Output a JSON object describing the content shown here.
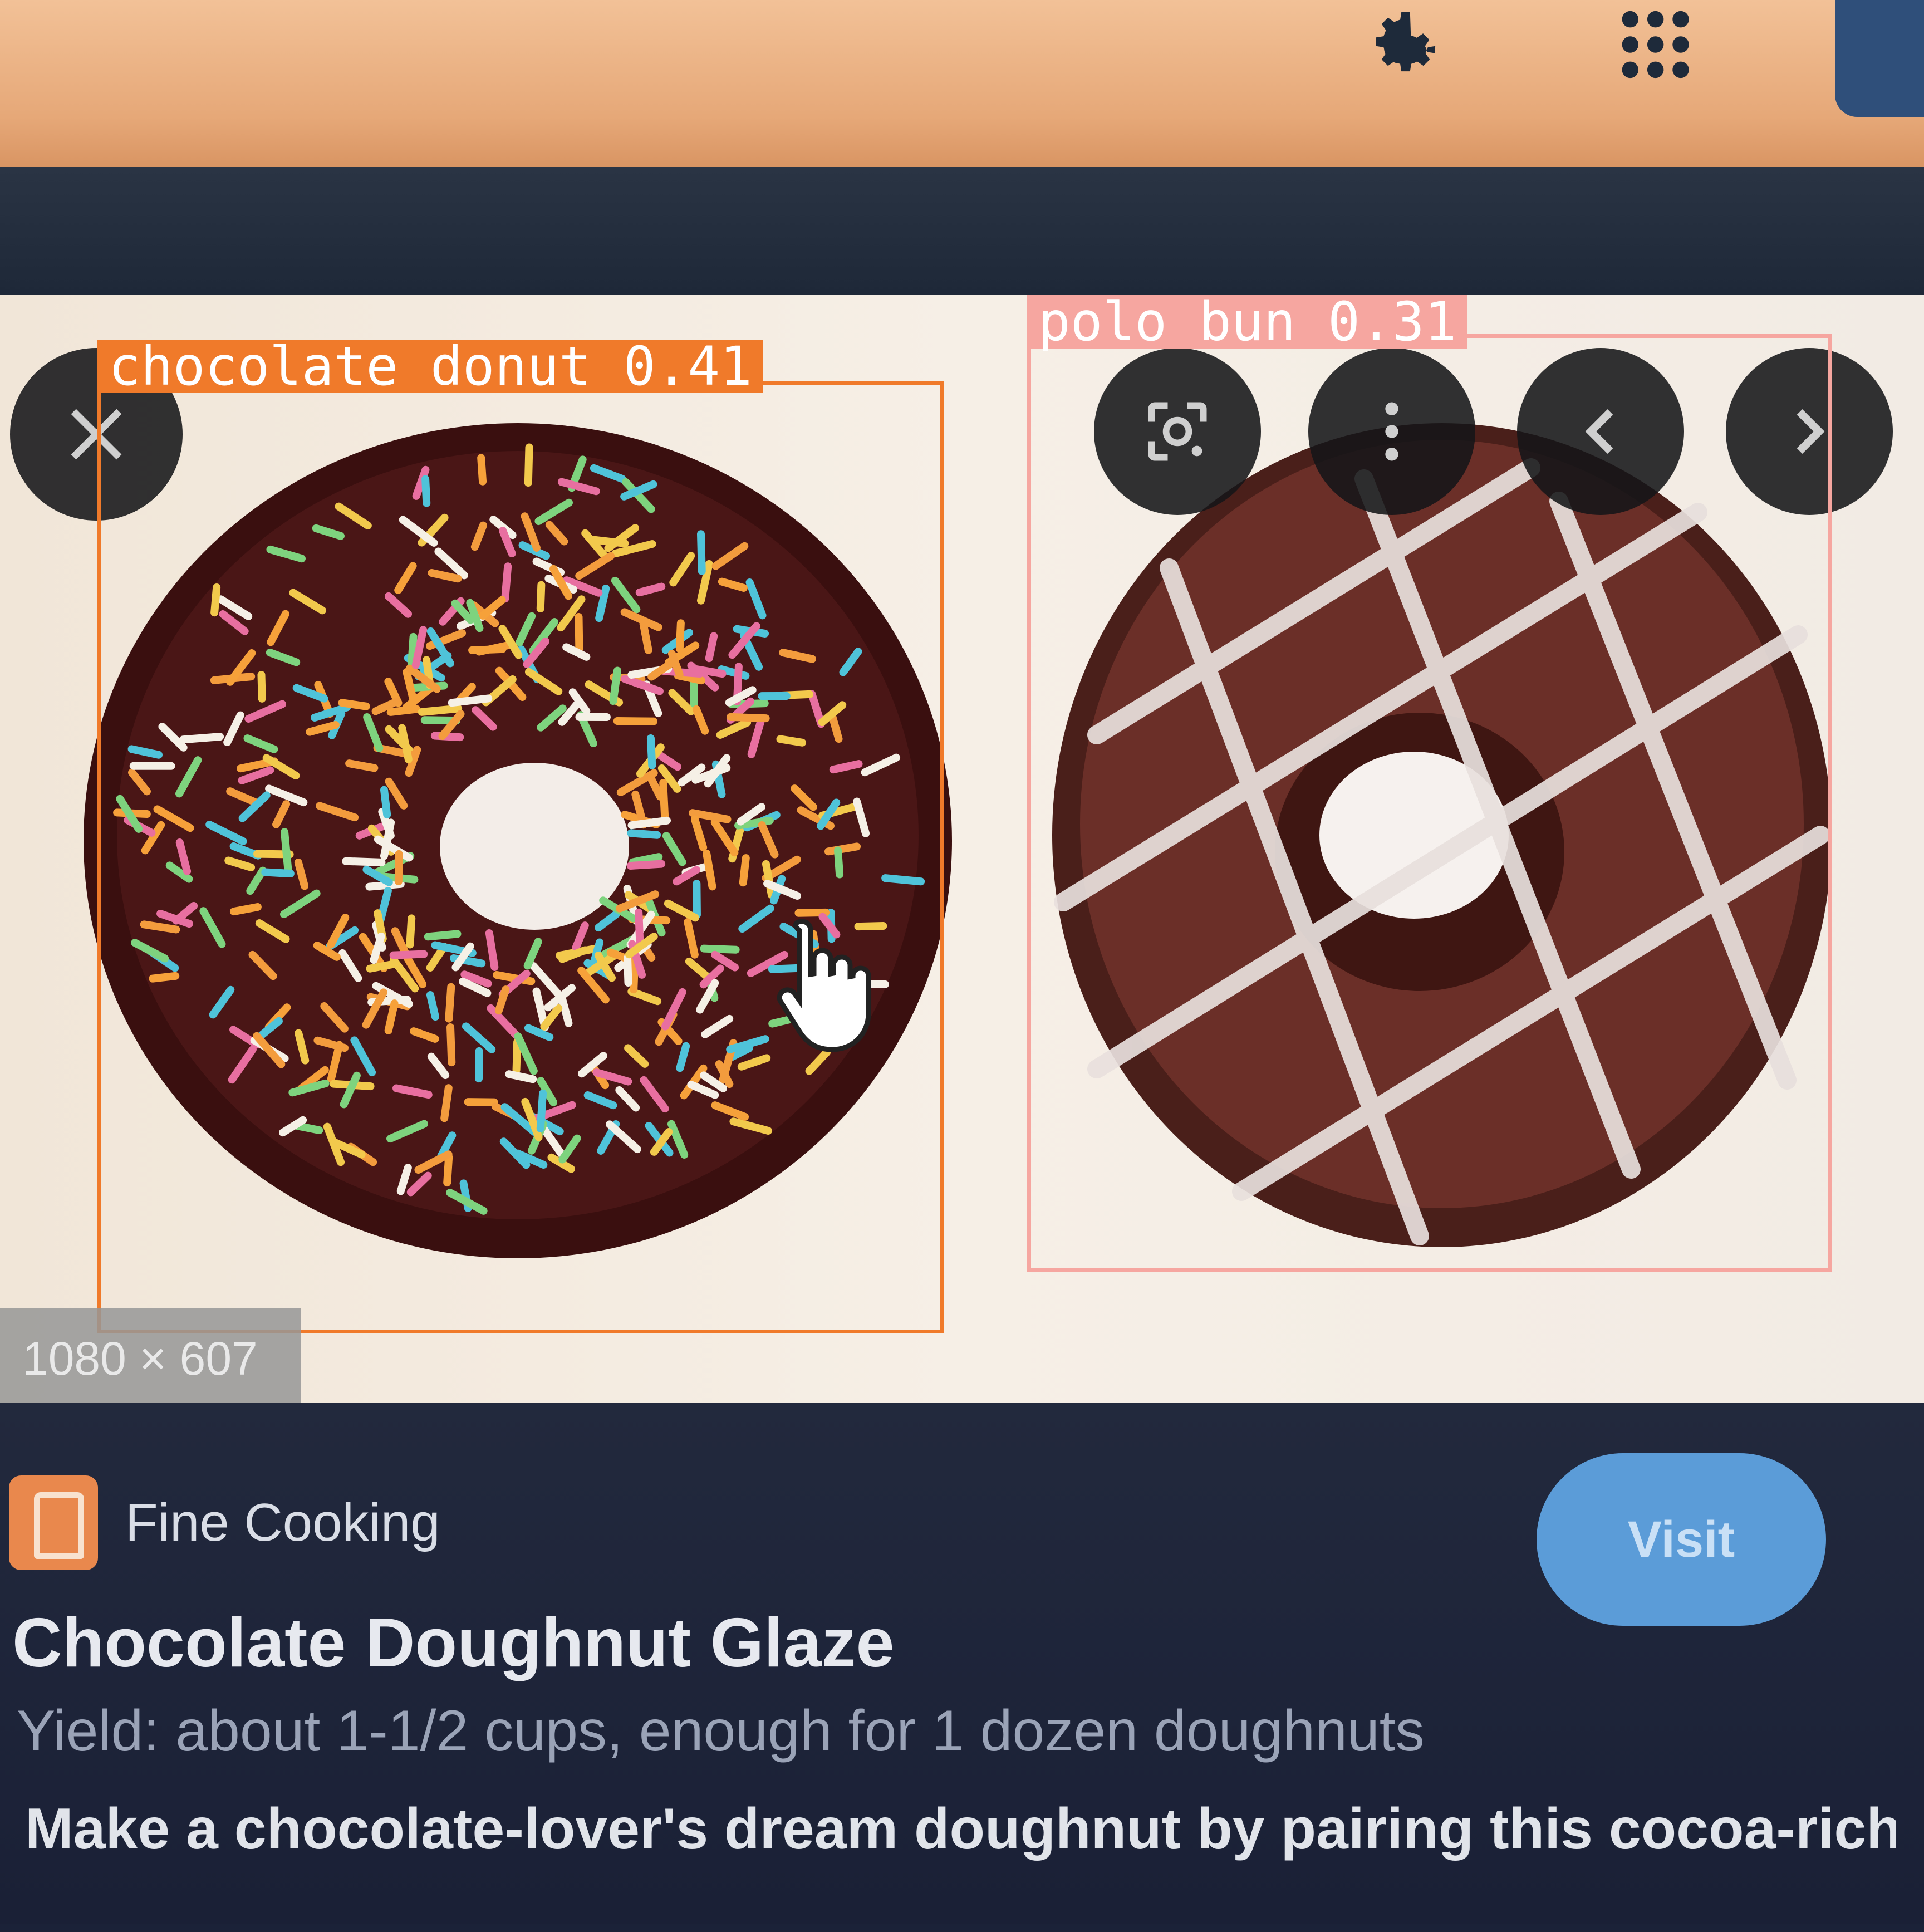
{
  "header": {
    "icons": [
      "gear-icon",
      "apps-grid-icon"
    ]
  },
  "preview": {
    "dimensions": "1080 × 607",
    "controls": [
      "close-icon",
      "lens-search-icon",
      "more-vert-icon",
      "chevron-left-icon",
      "chevron-right-icon"
    ]
  },
  "detections": [
    {
      "label": "chocolate donut 0.41",
      "color": "#f07a2a"
    },
    {
      "label": "polo bun 0.31",
      "color": "#f6a6a0"
    }
  ],
  "result": {
    "site_name": "Fine Cooking",
    "visit_label": "Visit",
    "title": "Chocolate Doughnut Glaze",
    "yield": "Yield: about 1-1/2 cups, enough for 1 dozen doughnuts",
    "description": "Make a chocolate-lover's dream doughnut by pairing this cocoa-rich glaze with chocolate baked ..."
  },
  "colors": {
    "header_bg": "#e6a878",
    "panel_bg": "#1b2238",
    "visit_button": "#5b9cd8",
    "accent_logo": "#e9884d"
  }
}
